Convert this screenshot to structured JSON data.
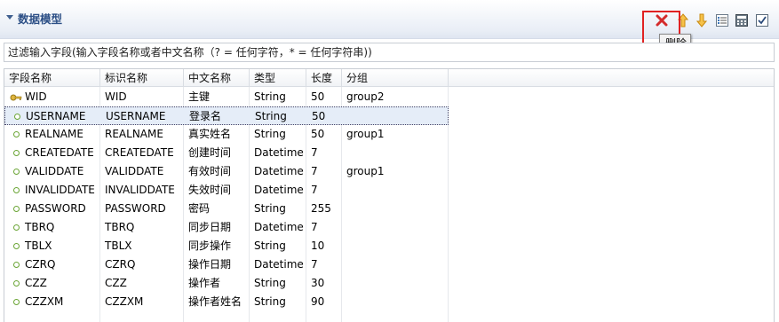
{
  "section": {
    "title": "数据模型"
  },
  "toolbar": {
    "items": [
      {
        "name": "delete",
        "icon": "close-icon",
        "color": "#d42b2b"
      },
      {
        "name": "move-up",
        "icon": "arrow-up-icon",
        "color": "#f0a318"
      },
      {
        "name": "move-down",
        "icon": "arrow-down-icon",
        "color": "#f0a318"
      },
      {
        "name": "list",
        "icon": "list-icon"
      },
      {
        "name": "calculator",
        "icon": "calculator-icon"
      },
      {
        "name": "check",
        "icon": "checkbox-icon"
      }
    ],
    "tooltip": "删除"
  },
  "filter": {
    "text": "过滤输入字段(输入字段名称或者中文名称（? = 任何字符，* = 任何字符串))"
  },
  "table": {
    "columns": [
      "字段名称",
      "标识名称",
      "中文名称",
      "类型",
      "长度",
      "分组"
    ],
    "rows": [
      {
        "icon": "key-icon",
        "field": "WID",
        "ident": "WID",
        "cn": "主键",
        "type": "String",
        "len": "50",
        "group": "group2"
      },
      {
        "icon": "dot-icon",
        "field": "USERNAME",
        "ident": "USERNAME",
        "cn": "登录名",
        "type": "String",
        "len": "50",
        "group": "",
        "selected": true
      },
      {
        "icon": "dot-icon",
        "field": "REALNAME",
        "ident": "REALNAME",
        "cn": "真实姓名",
        "type": "String",
        "len": "50",
        "group": "group1"
      },
      {
        "icon": "dot-icon",
        "field": "CREATEDATE",
        "ident": "CREATEDATE",
        "cn": "创建时间",
        "type": "Datetime",
        "len": "7",
        "group": ""
      },
      {
        "icon": "dot-icon",
        "field": "VALIDDATE",
        "ident": "VALIDDATE",
        "cn": "有效时间",
        "type": "Datetime",
        "len": "7",
        "group": "group1"
      },
      {
        "icon": "dot-icon",
        "field": "INVALIDDATE",
        "ident": "INVALIDDATE",
        "cn": "失效时间",
        "type": "Datetime",
        "len": "7",
        "group": ""
      },
      {
        "icon": "dot-icon",
        "field": "PASSWORD",
        "ident": "PASSWORD",
        "cn": "密码",
        "type": "String",
        "len": "255",
        "group": ""
      },
      {
        "icon": "dot-icon",
        "field": "TBRQ",
        "ident": "TBRQ",
        "cn": "同步日期",
        "type": "Datetime",
        "len": "7",
        "group": ""
      },
      {
        "icon": "dot-icon",
        "field": "TBLX",
        "ident": "TBLX",
        "cn": "同步操作",
        "type": "String",
        "len": "10",
        "group": ""
      },
      {
        "icon": "dot-icon",
        "field": "CZRQ",
        "ident": "CZRQ",
        "cn": "操作日期",
        "type": "Datetime",
        "len": "7",
        "group": ""
      },
      {
        "icon": "dot-icon",
        "field": "CZZ",
        "ident": "CZZ",
        "cn": "操作者",
        "type": "String",
        "len": "30",
        "group": ""
      },
      {
        "icon": "dot-icon",
        "field": "CZZXM",
        "ident": "CZZXM",
        "cn": "操作者姓名",
        "type": "String",
        "len": "90",
        "group": ""
      }
    ]
  },
  "colors": {
    "title": "#2c4f86",
    "highlight": "#e02222",
    "selection": "#e5edf8",
    "dot": "#6aa535"
  }
}
